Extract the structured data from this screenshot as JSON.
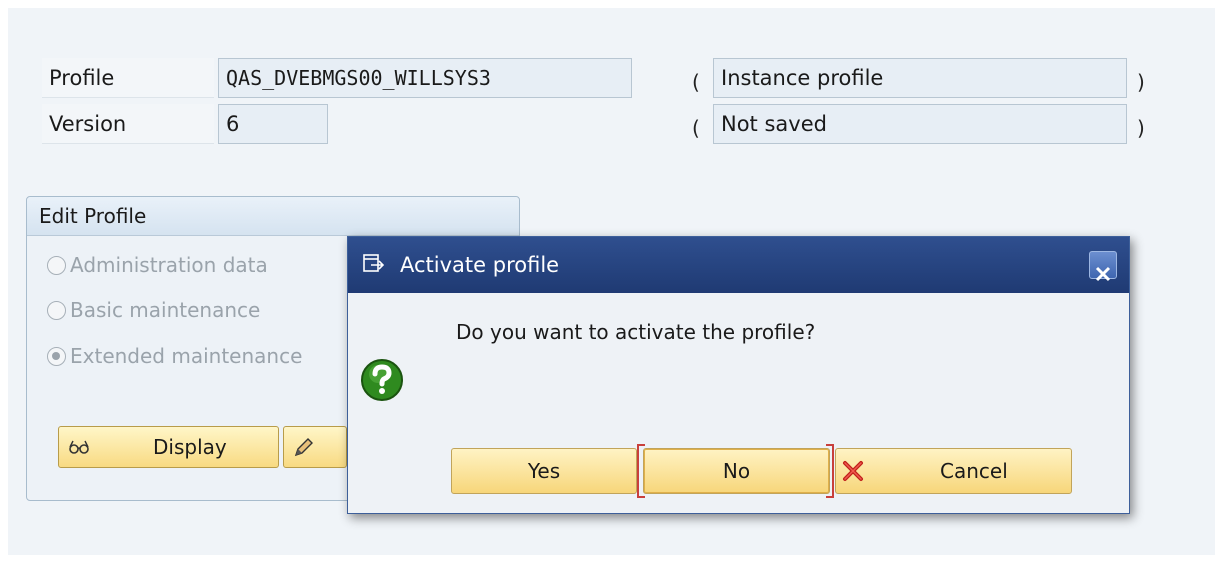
{
  "header": {
    "profile_label": "Profile",
    "profile_value": "QAS_DVEBMGS00_WILLSYS3",
    "version_label": "Version",
    "version_value": "6",
    "open_paren": "(",
    "close_paren": ")",
    "profile_type": "Instance profile",
    "save_status": "Not saved"
  },
  "edit_profile": {
    "title": "Edit Profile",
    "options": [
      {
        "label": "Administration data",
        "selected": false
      },
      {
        "label": "Basic maintenance",
        "selected": false
      },
      {
        "label": "Extended maintenance",
        "selected": true
      }
    ],
    "display_button": "Display",
    "display_icon": "glasses-icon",
    "change_icon": "pencil-icon"
  },
  "dialog": {
    "title": "Activate profile",
    "title_icon": "dialog-window-icon",
    "question": "Do you want to activate the profile?",
    "question_icon": "question-icon",
    "buttons": {
      "yes": "Yes",
      "no": "No",
      "cancel": "Cancel"
    },
    "cancel_icon": "red-x-icon",
    "focused_button": "No"
  },
  "colors": {
    "titlebar": "#1f3a73",
    "button": "#f8da82",
    "focus": "#c8403c",
    "question_icon": "#2f8a1f"
  }
}
